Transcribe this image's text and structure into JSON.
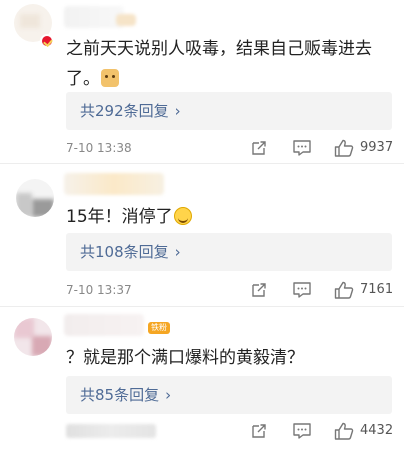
{
  "comments": [
    {
      "text": "之前天天说别人吸毒，结果自己贩毒进去了。",
      "emoji": "doge-icon",
      "replies": "共292条回复",
      "time": "7-10 13:38",
      "likes": "9937"
    },
    {
      "text": "15年！消停了",
      "emoji": "smile-icon",
      "replies": "共108条回复",
      "time": "7-10 13:37",
      "likes": "7161"
    },
    {
      "text": "？就是那个满口爆料的黄毅清？",
      "replies": "共85条回复",
      "time": "",
      "likes": "4432"
    }
  ],
  "badge_vip_text": "铁粉",
  "colors": {
    "link": "#4f6b96",
    "reply_bg": "#f3f3f3",
    "verified_badge": "#e6162d",
    "meta": "#888888"
  },
  "icons": [
    "share-icon",
    "comment-icon",
    "like-icon",
    "chevron-right-icon"
  ],
  "chevron": "›"
}
